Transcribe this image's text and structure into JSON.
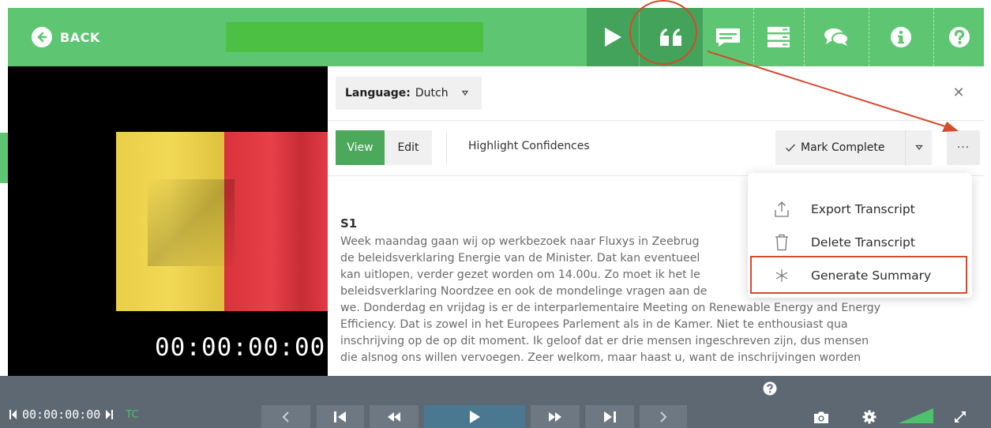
{
  "header": {
    "back_label": "BACK",
    "buttons": [
      {
        "id": "play",
        "icon": "play-icon"
      },
      {
        "id": "quote",
        "icon": "quote-icon"
      },
      {
        "id": "subtitle",
        "icon": "subtitle-icon"
      },
      {
        "id": "list",
        "icon": "list-icon"
      },
      {
        "id": "comments",
        "icon": "comments-icon"
      },
      {
        "id": "info",
        "icon": "info-icon"
      },
      {
        "id": "help",
        "icon": "help-icon"
      }
    ],
    "colors": {
      "bar": "#5ec672",
      "active": "#43a35a",
      "title_box": "#4cc043"
    }
  },
  "video": {
    "timecode": "00:00:00:00",
    "flag_colors": [
      "#000000",
      "#f0d54a",
      "#e5393b"
    ]
  },
  "panel": {
    "language_label": "Language:",
    "language_value": "Dutch",
    "view_label": "View",
    "edit_label": "Edit",
    "highlight_label": "Highlight Confidences",
    "mark_complete_label": "Mark Complete",
    "more_label": "···",
    "speaker": "S1",
    "transcript_lines": [
      "Week maandag gaan wij op werkbezoek naar Fluxys in Zeebrug",
      "de beleidsverklaring Energie van de Minister. Dat kan eventueel",
      "kan uitlopen, verder gezet worden om 14.00u. Zo moet ik het le",
      "beleidsverklaring Noordzee en ook de mondelinge vragen aan de",
      "we. Donderdag en vrijdag is er de interparlementaire Meeting on Renewable Energy and Energy",
      "Efficiency. Dat is zowel in het Europees Parlement als in de Kamer. Niet te enthousiast qua",
      "inschrijving op de op dit moment. Ik geloof dat er drie mensen ingeschreven zijn, dus mensen",
      "die alsnog ons willen vervoegen. Zeer welkom, maar haast u, want de inschrijvingen worden"
    ]
  },
  "menu": {
    "items": [
      {
        "label": "Export Transcript",
        "icon": "export-icon"
      },
      {
        "label": "Delete Transcript",
        "icon": "trash-icon"
      },
      {
        "label": "Generate Summary",
        "icon": "asterisk-icon"
      }
    ]
  },
  "footer": {
    "timecode": "00:00:00:00",
    "tc_label": "TC",
    "colors": {
      "bar": "#5d6873",
      "button": "#6d7883",
      "play": "#497890",
      "tc": "#4ec26a"
    }
  },
  "annotation": {
    "color": "#d24b2d"
  }
}
